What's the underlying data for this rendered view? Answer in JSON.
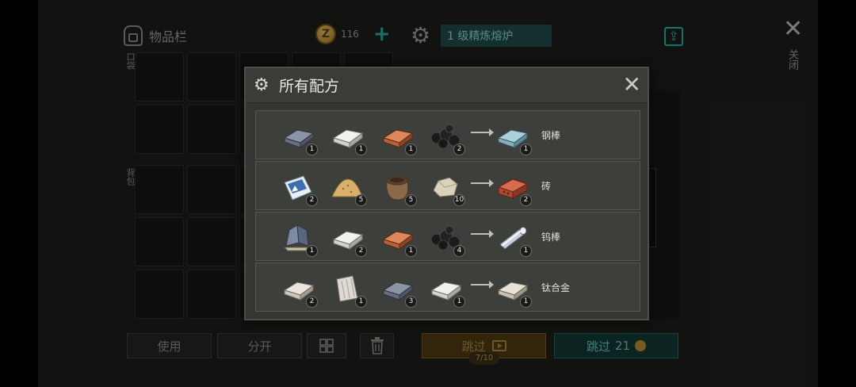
{
  "inventory": {
    "title": "物品栏",
    "coins": "116",
    "coin_symbol": "Z",
    "pocket_label": "口袋",
    "bag_label": "背包"
  },
  "furnace": {
    "name": "1 级精炼熔炉"
  },
  "close": {
    "symbol": "✕",
    "label": "关闭"
  },
  "bottom": {
    "use_label": "使用",
    "split_label": "分开",
    "skip_video_label": "跳过",
    "skip_video_count": "7/10",
    "skip_coin_label": "跳过",
    "skip_coin_cost": "21"
  },
  "modal": {
    "title": "所有配方",
    "close_symbol": "✕",
    "recipes": [
      {
        "inputs": [
          {
            "icon": "iron-bar-icon",
            "count": "1"
          },
          {
            "icon": "aluminum-bar-icon",
            "count": "1"
          },
          {
            "icon": "copper-bar-icon",
            "count": "1"
          },
          {
            "icon": "coal-icon",
            "count": "2"
          }
        ],
        "output": {
          "icon": "steel-bar-icon",
          "count": "1",
          "name": "钢棒"
        }
      },
      {
        "inputs": [
          {
            "icon": "cement-bag-icon",
            "count": "2"
          },
          {
            "icon": "sand-pile-icon",
            "count": "5"
          },
          {
            "icon": "soil-sack-icon",
            "count": "5"
          },
          {
            "icon": "stone-icon",
            "count": "10"
          }
        ],
        "output": {
          "icon": "brick-icon",
          "count": "2",
          "name": "砖"
        }
      },
      {
        "inputs": [
          {
            "icon": "tungsten-ore-icon",
            "count": "1"
          },
          {
            "icon": "aluminum-bar-icon",
            "count": "2"
          },
          {
            "icon": "copper-bar-icon",
            "count": "1"
          },
          {
            "icon": "coal-icon",
            "count": "4"
          }
        ],
        "output": {
          "icon": "tungsten-rod-icon",
          "count": "1",
          "name": "钨棒"
        }
      },
      {
        "inputs": [
          {
            "icon": "silver-bar-icon",
            "count": "2"
          },
          {
            "icon": "titanium-ore-icon",
            "count": "1"
          },
          {
            "icon": "iron-bar-icon",
            "count": "3"
          },
          {
            "icon": "aluminum-bar-icon",
            "count": "1"
          }
        ],
        "output": {
          "icon": "titanium-alloy-icon",
          "count": "1",
          "name": "钛合金"
        }
      }
    ]
  }
}
